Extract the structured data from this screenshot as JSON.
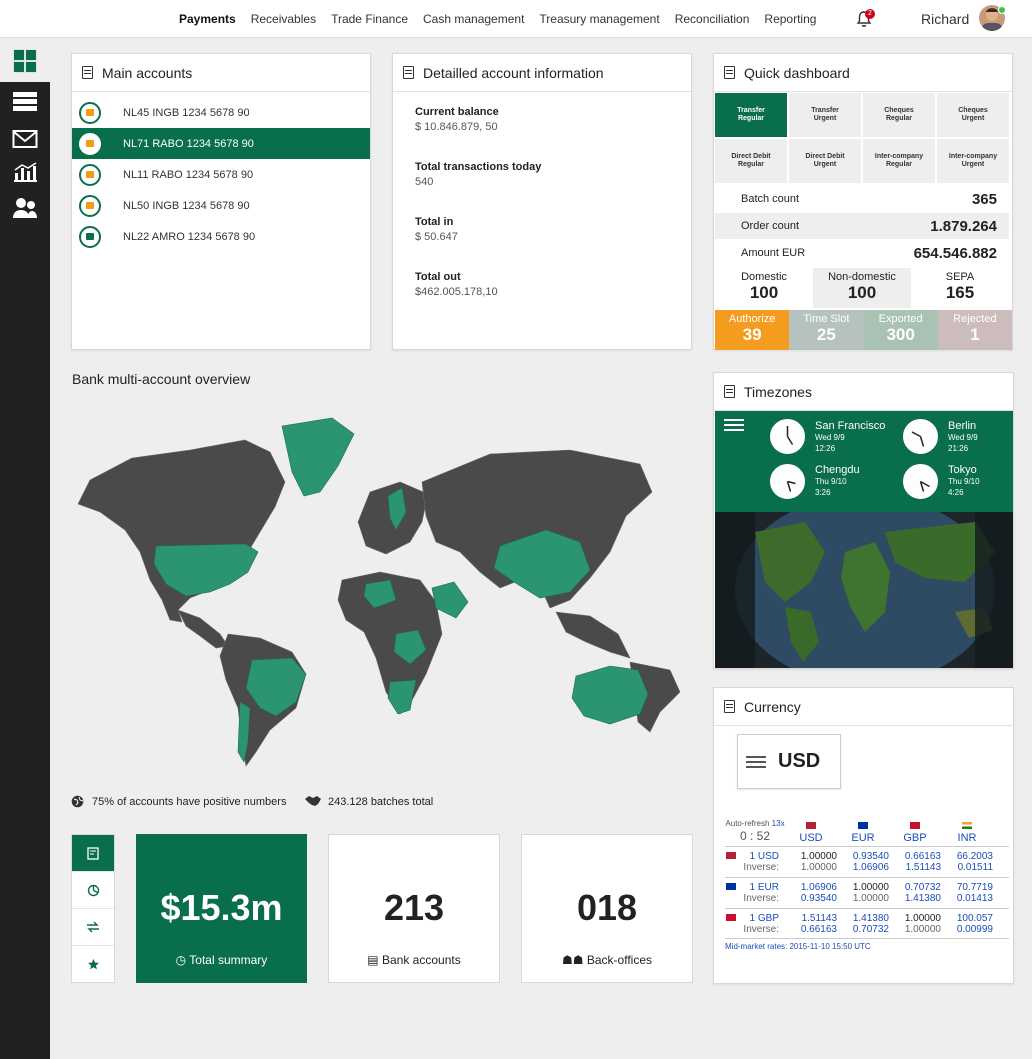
{
  "nav": {
    "items": [
      "Payments",
      "Receivables",
      "Trade Finance",
      "Cash management",
      "Treasury management",
      "Reconciliation",
      "Reporting"
    ],
    "active": "Payments"
  },
  "user": {
    "name": "Richard",
    "notifications": "2"
  },
  "main_accounts": {
    "title": "Main accounts",
    "accounts": [
      "NL45 INGB 1234 5678 90",
      "NL71 RABO 1234 5678 90",
      "NL11 RABO 1234 5678 90",
      "NL50 INGB 1234 5678 90",
      "NL22 AMRO 1234 5678 90"
    ],
    "selected_index": 1
  },
  "detail": {
    "title": "Detailled account information",
    "items": [
      {
        "label": "Current balance",
        "value": "$ 10.846.879, 50"
      },
      {
        "label": "Total transactions today",
        "value": "540"
      },
      {
        "label": "Total in",
        "value": "$ 50.647"
      },
      {
        "label": "Total out",
        "value": "$462.005.178,10"
      }
    ]
  },
  "quick": {
    "title": "Quick dashboard",
    "buttons": [
      {
        "l1": "Transfer",
        "l2": "Regular"
      },
      {
        "l1": "Transfer",
        "l2": "Urgent"
      },
      {
        "l1": "Cheques",
        "l2": "Regular"
      },
      {
        "l1": "Cheques",
        "l2": "Urgent"
      },
      {
        "l1": "Direct Debit",
        "l2": "Regular"
      },
      {
        "l1": "Direct Debit",
        "l2": "Urgent"
      },
      {
        "l1": "Inter-company",
        "l2": "Regular"
      },
      {
        "l1": "Inter-company",
        "l2": "Urgent"
      }
    ],
    "rows": [
      {
        "label": "Batch count",
        "value": "365"
      },
      {
        "label": "Order count",
        "value": "1.879.264"
      },
      {
        "label": "Amount EUR",
        "value": "654.546.882"
      }
    ],
    "split": [
      {
        "label": "Domestic",
        "value": "100"
      },
      {
        "label": "Non-domestic",
        "value": "100"
      },
      {
        "label": "SEPA",
        "value": "165"
      }
    ],
    "status": [
      {
        "label": "Authorize",
        "value": "39",
        "color": "#f39c1f"
      },
      {
        "label": "Time Slot",
        "value": "25",
        "color": "#b6c2c0"
      },
      {
        "label": "Exported",
        "value": "300",
        "color": "#a9c2b4"
      },
      {
        "label": "Rejected",
        "value": "1",
        "color": "#cdbcbc"
      }
    ]
  },
  "map": {
    "title": "Bank multi-account overview",
    "stat1": "75% of accounts have positive numbers",
    "stat2": "243.128 batches total"
  },
  "kpis": [
    {
      "value": "$15.3m",
      "caption": "Total summary"
    },
    {
      "value": "213",
      "caption": "Bank accounts"
    },
    {
      "value": "018",
      "caption": "Back-offices"
    }
  ],
  "timezones": {
    "title": "Timezones",
    "cities": [
      {
        "name": "San Francisco",
        "day": "Wed 9/9",
        "time": "12:26"
      },
      {
        "name": "Berlin",
        "day": "Wed 9/9",
        "time": "21:26"
      },
      {
        "name": "Chengdu",
        "day": "Thu 9/10",
        "time": "3:26"
      },
      {
        "name": "Tokyo",
        "day": "Thu 9/10",
        "time": "4:26"
      }
    ]
  },
  "currency": {
    "title": "Currency",
    "selected": "USD",
    "autorefresh_label": "Auto-refresh",
    "autorefresh_value": "13x",
    "countdown": "0 : 52",
    "columns": [
      "USD",
      "EUR",
      "GBP",
      "INR"
    ],
    "rows": [
      {
        "label": "1 USD",
        "values": [
          "1.00000",
          "0.93540",
          "0.66163",
          "66.2003"
        ],
        "inverse": [
          "1.00000",
          "1.06906",
          "1.51143",
          "0.01511"
        ]
      },
      {
        "label": "1 EUR",
        "values": [
          "1.06906",
          "1.00000",
          "0.70732",
          "70.7719"
        ],
        "inverse": [
          "0.93540",
          "1.00000",
          "1.41380",
          "0.01413"
        ]
      },
      {
        "label": "1 GBP",
        "values": [
          "1.51143",
          "1.41380",
          "1.00000",
          "100.057"
        ],
        "inverse": [
          "0.66163",
          "0.70732",
          "1.00000",
          "0.00999"
        ]
      }
    ],
    "inverse_label": "Inverse:",
    "footer": "Mid-market rates: 2015-11-10 15:50 UTC"
  },
  "colors": {
    "brand_green": "#096e4a",
    "map_land": "#4a4a4a",
    "map_highlight": "#2b9471",
    "authorize": "#f39c1f"
  }
}
